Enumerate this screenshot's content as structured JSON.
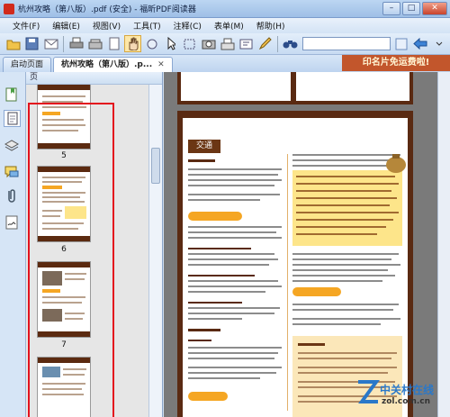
{
  "window": {
    "title": "杭州攻略（第八版）.pdf (安全) - 福昕PDF阅读器"
  },
  "menu": [
    "文件(F)",
    "编辑(E)",
    "视图(V)",
    "工具(T)",
    "注释(C)",
    "表单(M)",
    "帮助(H)"
  ],
  "tabs": [
    {
      "label": "启动页面"
    },
    {
      "label": "杭州攻略（第八版）.p..."
    }
  ],
  "banner": {
    "text": "印名片免运费啦!"
  },
  "panel": {
    "header": "页"
  },
  "thumbnails": [
    {
      "number": "5"
    },
    {
      "number": "6"
    },
    {
      "number": "7"
    }
  ],
  "document": {
    "section_title": "交通"
  },
  "watermark": {
    "text": "中关村在线",
    "sub": "zol.com.cn"
  },
  "colors": {
    "selection": "#e3111d",
    "page_brown": "#5a2a12",
    "accent_orange": "#f5a623"
  },
  "icons": [
    "open-file-icon",
    "save-icon",
    "email-icon",
    "print-icon",
    "hand-tool-icon",
    "select-text-icon",
    "zoom-icon",
    "search-icon",
    "back-arrow-icon"
  ]
}
